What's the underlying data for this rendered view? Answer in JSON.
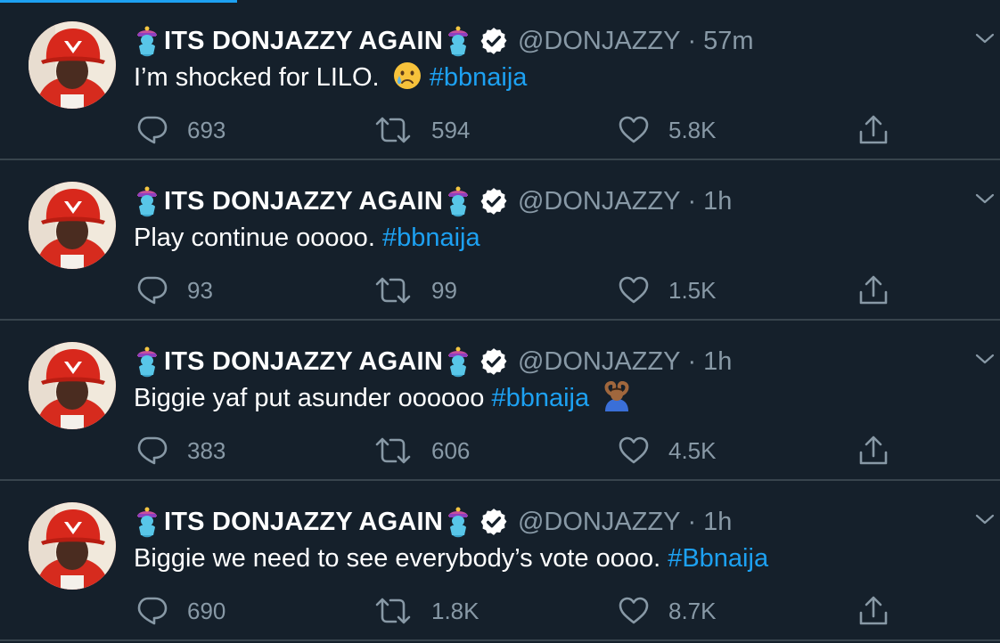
{
  "progress_fraction": 0.237,
  "colors": {
    "background": "#15202b",
    "divider": "#38444d",
    "secondary_text": "#8899a6",
    "link": "#1da1f2",
    "avatar_red": "#d93a2b"
  },
  "tweets": [
    {
      "display_name": "ITS DONJAZZY AGAIN",
      "handle": "@DONJAZZY",
      "separator": "·",
      "time": "57m",
      "text": "I’m shocked for LILO. ",
      "hashtag": "#bbnaija",
      "emoji": "crying-face",
      "emoji_position": "before-hashtag",
      "replies": "693",
      "retweets": "594",
      "likes": "5.8K"
    },
    {
      "display_name": "ITS DONJAZZY AGAIN",
      "handle": "@DONJAZZY",
      "separator": "·",
      "time": "1h",
      "text": "Play continue ooooo. ",
      "hashtag": "#bbnaija",
      "emoji": "",
      "emoji_position": "",
      "replies": "93",
      "retweets": "99",
      "likes": "1.5K"
    },
    {
      "display_name": "ITS DONJAZZY AGAIN",
      "handle": "@DONJAZZY",
      "separator": "·",
      "time": "1h",
      "text": "Biggie yaf put asunder  oooooo ",
      "hashtag": "#bbnaija",
      "emoji": "person-gesturing-ok",
      "emoji_position": "after-hashtag",
      "replies": "383",
      "retweets": "606",
      "likes": "4.5K"
    },
    {
      "display_name": "ITS DONJAZZY AGAIN",
      "handle": "@DONJAZZY",
      "separator": "·",
      "time": "1h",
      "text": "Biggie we need to see everybody’s vote oooo. ",
      "hashtag": "#Bbnaija",
      "emoji": "",
      "emoji_position": "",
      "replies": "690",
      "retweets": "1.8K",
      "likes": "8.7K"
    }
  ]
}
